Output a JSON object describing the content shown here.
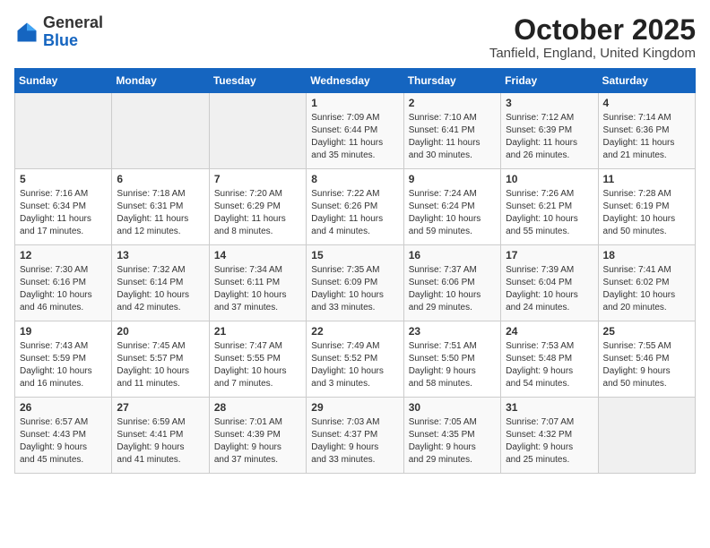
{
  "logo": {
    "general": "General",
    "blue": "Blue"
  },
  "header": {
    "month": "October 2025",
    "location": "Tanfield, England, United Kingdom"
  },
  "weekdays": [
    "Sunday",
    "Monday",
    "Tuesday",
    "Wednesday",
    "Thursday",
    "Friday",
    "Saturday"
  ],
  "weeks": [
    [
      {
        "day": "",
        "content": ""
      },
      {
        "day": "",
        "content": ""
      },
      {
        "day": "",
        "content": ""
      },
      {
        "day": "1",
        "content": "Sunrise: 7:09 AM\nSunset: 6:44 PM\nDaylight: 11 hours\nand 35 minutes."
      },
      {
        "day": "2",
        "content": "Sunrise: 7:10 AM\nSunset: 6:41 PM\nDaylight: 11 hours\nand 30 minutes."
      },
      {
        "day": "3",
        "content": "Sunrise: 7:12 AM\nSunset: 6:39 PM\nDaylight: 11 hours\nand 26 minutes."
      },
      {
        "day": "4",
        "content": "Sunrise: 7:14 AM\nSunset: 6:36 PM\nDaylight: 11 hours\nand 21 minutes."
      }
    ],
    [
      {
        "day": "5",
        "content": "Sunrise: 7:16 AM\nSunset: 6:34 PM\nDaylight: 11 hours\nand 17 minutes."
      },
      {
        "day": "6",
        "content": "Sunrise: 7:18 AM\nSunset: 6:31 PM\nDaylight: 11 hours\nand 12 minutes."
      },
      {
        "day": "7",
        "content": "Sunrise: 7:20 AM\nSunset: 6:29 PM\nDaylight: 11 hours\nand 8 minutes."
      },
      {
        "day": "8",
        "content": "Sunrise: 7:22 AM\nSunset: 6:26 PM\nDaylight: 11 hours\nand 4 minutes."
      },
      {
        "day": "9",
        "content": "Sunrise: 7:24 AM\nSunset: 6:24 PM\nDaylight: 10 hours\nand 59 minutes."
      },
      {
        "day": "10",
        "content": "Sunrise: 7:26 AM\nSunset: 6:21 PM\nDaylight: 10 hours\nand 55 minutes."
      },
      {
        "day": "11",
        "content": "Sunrise: 7:28 AM\nSunset: 6:19 PM\nDaylight: 10 hours\nand 50 minutes."
      }
    ],
    [
      {
        "day": "12",
        "content": "Sunrise: 7:30 AM\nSunset: 6:16 PM\nDaylight: 10 hours\nand 46 minutes."
      },
      {
        "day": "13",
        "content": "Sunrise: 7:32 AM\nSunset: 6:14 PM\nDaylight: 10 hours\nand 42 minutes."
      },
      {
        "day": "14",
        "content": "Sunrise: 7:34 AM\nSunset: 6:11 PM\nDaylight: 10 hours\nand 37 minutes."
      },
      {
        "day": "15",
        "content": "Sunrise: 7:35 AM\nSunset: 6:09 PM\nDaylight: 10 hours\nand 33 minutes."
      },
      {
        "day": "16",
        "content": "Sunrise: 7:37 AM\nSunset: 6:06 PM\nDaylight: 10 hours\nand 29 minutes."
      },
      {
        "day": "17",
        "content": "Sunrise: 7:39 AM\nSunset: 6:04 PM\nDaylight: 10 hours\nand 24 minutes."
      },
      {
        "day": "18",
        "content": "Sunrise: 7:41 AM\nSunset: 6:02 PM\nDaylight: 10 hours\nand 20 minutes."
      }
    ],
    [
      {
        "day": "19",
        "content": "Sunrise: 7:43 AM\nSunset: 5:59 PM\nDaylight: 10 hours\nand 16 minutes."
      },
      {
        "day": "20",
        "content": "Sunrise: 7:45 AM\nSunset: 5:57 PM\nDaylight: 10 hours\nand 11 minutes."
      },
      {
        "day": "21",
        "content": "Sunrise: 7:47 AM\nSunset: 5:55 PM\nDaylight: 10 hours\nand 7 minutes."
      },
      {
        "day": "22",
        "content": "Sunrise: 7:49 AM\nSunset: 5:52 PM\nDaylight: 10 hours\nand 3 minutes."
      },
      {
        "day": "23",
        "content": "Sunrise: 7:51 AM\nSunset: 5:50 PM\nDaylight: 9 hours\nand 58 minutes."
      },
      {
        "day": "24",
        "content": "Sunrise: 7:53 AM\nSunset: 5:48 PM\nDaylight: 9 hours\nand 54 minutes."
      },
      {
        "day": "25",
        "content": "Sunrise: 7:55 AM\nSunset: 5:46 PM\nDaylight: 9 hours\nand 50 minutes."
      }
    ],
    [
      {
        "day": "26",
        "content": "Sunrise: 6:57 AM\nSunset: 4:43 PM\nDaylight: 9 hours\nand 45 minutes."
      },
      {
        "day": "27",
        "content": "Sunrise: 6:59 AM\nSunset: 4:41 PM\nDaylight: 9 hours\nand 41 minutes."
      },
      {
        "day": "28",
        "content": "Sunrise: 7:01 AM\nSunset: 4:39 PM\nDaylight: 9 hours\nand 37 minutes."
      },
      {
        "day": "29",
        "content": "Sunrise: 7:03 AM\nSunset: 4:37 PM\nDaylight: 9 hours\nand 33 minutes."
      },
      {
        "day": "30",
        "content": "Sunrise: 7:05 AM\nSunset: 4:35 PM\nDaylight: 9 hours\nand 29 minutes."
      },
      {
        "day": "31",
        "content": "Sunrise: 7:07 AM\nSunset: 4:32 PM\nDaylight: 9 hours\nand 25 minutes."
      },
      {
        "day": "",
        "content": ""
      }
    ]
  ]
}
